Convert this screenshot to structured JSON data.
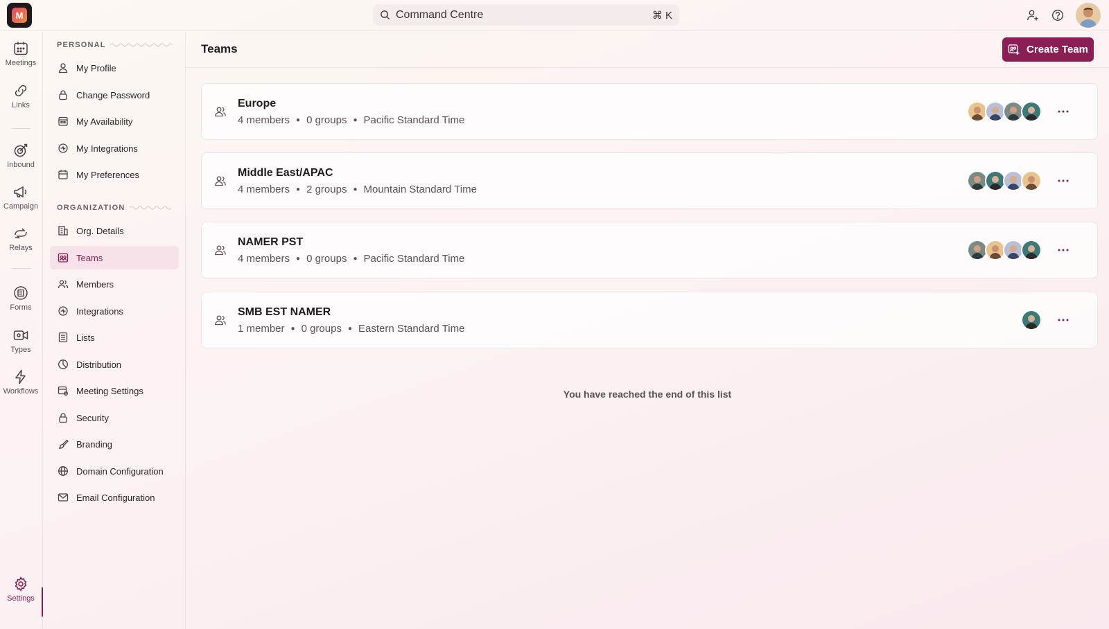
{
  "app": {
    "logo_text": "M"
  },
  "topbar": {
    "search_label": "Command Centre",
    "search_shortcut": "⌘ K",
    "icons": [
      "search-icon",
      "add-user-icon",
      "help-icon",
      "user-avatar"
    ]
  },
  "rail": {
    "items": [
      {
        "label": "Meetings",
        "icon": "calendar-icon"
      },
      {
        "label": "Links",
        "icon": "link-icon"
      },
      {
        "label": "Inbound",
        "icon": "inbound-icon"
      },
      {
        "label": "Campaign",
        "icon": "megaphone-icon"
      },
      {
        "label": "Relays",
        "icon": "relay-icon"
      },
      {
        "label": "Forms",
        "icon": "form-icon"
      },
      {
        "label": "Types",
        "icon": "video-icon"
      },
      {
        "label": "Workflows",
        "icon": "bolt-icon"
      },
      {
        "label": "Settings",
        "icon": "gear-icon"
      }
    ],
    "active": "Settings"
  },
  "sidebar": {
    "personal_heading": "PERSONAL",
    "personal": [
      {
        "label": "My Profile",
        "icon": "user-icon"
      },
      {
        "label": "Change Password",
        "icon": "lock-icon"
      },
      {
        "label": "My Availability",
        "icon": "calendar-grid-icon"
      },
      {
        "label": "My Integrations",
        "icon": "integration-icon"
      },
      {
        "label": "My Preferences",
        "icon": "calendar-icon"
      }
    ],
    "organization_heading": "ORGANIZATION",
    "organization": [
      {
        "label": "Org. Details",
        "icon": "building-icon"
      },
      {
        "label": "Teams",
        "icon": "team-icon"
      },
      {
        "label": "Members",
        "icon": "members-icon"
      },
      {
        "label": "Integrations",
        "icon": "integration-icon"
      },
      {
        "label": "Lists",
        "icon": "list-icon"
      },
      {
        "label": "Distribution",
        "icon": "pie-icon"
      },
      {
        "label": "Meeting Settings",
        "icon": "meeting-settings-icon"
      },
      {
        "label": "Security",
        "icon": "lock-icon"
      },
      {
        "label": "Branding",
        "icon": "brush-icon"
      },
      {
        "label": "Domain Configuration",
        "icon": "globe-icon"
      },
      {
        "label": "Email Configuration",
        "icon": "mail-icon"
      }
    ],
    "active": "Teams"
  },
  "main": {
    "title": "Teams",
    "create_button": "Create Team",
    "teams": [
      {
        "name": "Europe",
        "members": "4 members",
        "groups": "0 groups",
        "timezone": "Pacific Standard Time",
        "avatar_count": 4
      },
      {
        "name": "Middle East/APAC",
        "members": "4 members",
        "groups": "2 groups",
        "timezone": "Mountain Standard Time",
        "avatar_count": 4
      },
      {
        "name": "NAMER PST",
        "members": "4 members",
        "groups": "0 groups",
        "timezone": "Pacific Standard Time",
        "avatar_count": 4
      },
      {
        "name": "SMB EST NAMER",
        "members": "1 member",
        "groups": "0 groups",
        "timezone": "Eastern Standard Time",
        "avatar_count": 1
      }
    ],
    "end_note": "You have reached the end of this list"
  },
  "colors": {
    "accent": "#8a1f56",
    "active_bg": "#f6e2e8",
    "text": "#2b2326",
    "muted": "#5c5155"
  }
}
